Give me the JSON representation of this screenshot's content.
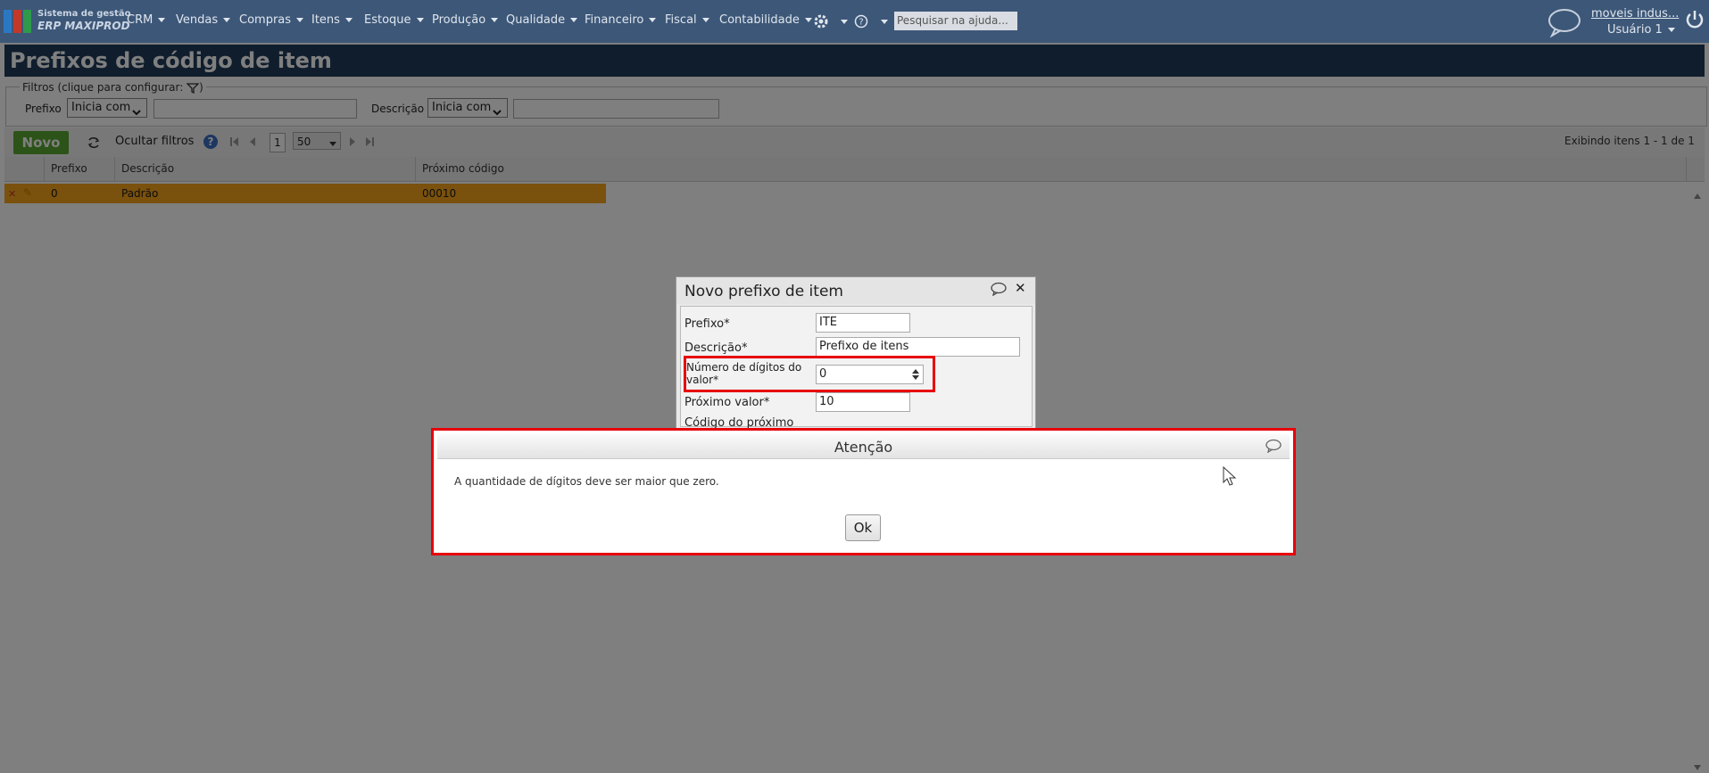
{
  "app": {
    "logo_line1": "Sistema de gestão",
    "logo_line2": "ERP MAXIPROD",
    "search_placeholder": "Pesquisar na ajuda...",
    "company": "moveis indus...",
    "user": "Usuário 1"
  },
  "nav": [
    {
      "label": "CRM"
    },
    {
      "label": "Vendas"
    },
    {
      "label": "Compras"
    },
    {
      "label": "Itens"
    },
    {
      "label": "Estoque"
    },
    {
      "label": "Produção"
    },
    {
      "label": "Qualidade"
    },
    {
      "label": "Financeiro"
    },
    {
      "label": "Fiscal"
    },
    {
      "label": "Contabilidade"
    }
  ],
  "page": {
    "title": "Prefixos de código de item"
  },
  "filters": {
    "legend": "Filtros (clique para configurar:",
    "legend_end": ")",
    "prefixo_label": "Prefixo",
    "prefixo_op": "Inicia com",
    "descricao_label": "Descrição",
    "descricao_op": "Inicia com"
  },
  "toolbar": {
    "novo": "Novo",
    "ocultar": "Ocultar filtros",
    "page": "1",
    "page_size": "50",
    "summary": "Exibindo itens 1 - 1 de 1"
  },
  "grid": {
    "columns": [
      "Prefixo",
      "Descrição",
      "Próximo código"
    ],
    "rows": [
      {
        "prefixo": "0",
        "descricao": "Padrão",
        "proximo": "00010"
      }
    ]
  },
  "dialog": {
    "title": "Novo prefixo de item",
    "prefixo_label": "Prefixo*",
    "prefixo_value": "ITE",
    "descricao_label": "Descrição*",
    "descricao_value": "Prefixo de itens",
    "digitos_label_1": "Número de dígitos do",
    "digitos_label_2": "valor*",
    "digitos_value": "0",
    "proximo_label": "Próximo valor*",
    "proximo_value": "10",
    "codigo_label": "Código do próximo"
  },
  "alert": {
    "title": "Atenção",
    "message": "A quantidade de dígitos deve ser maior que zero.",
    "ok": "Ok"
  },
  "colors": {
    "nav_bg": "#3d5778",
    "title_bg": "#1e3a5a",
    "novo_green": "#58a630",
    "row_highlight": "#f4a21b",
    "annotation_red": "#e8000b"
  }
}
